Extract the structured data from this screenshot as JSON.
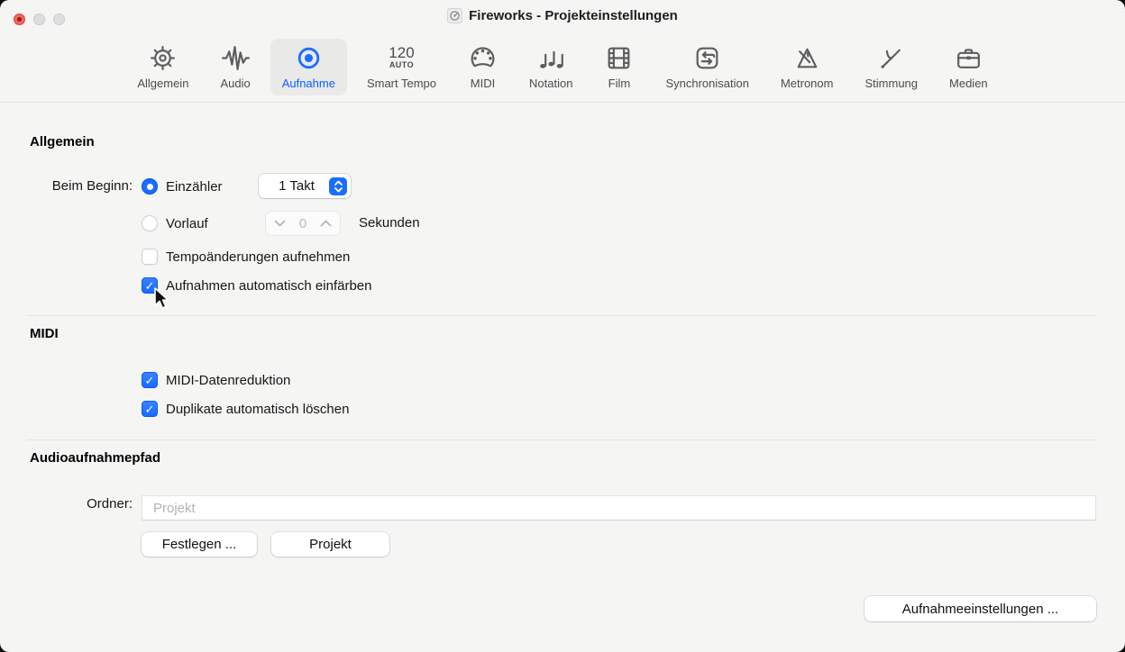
{
  "window": {
    "title": "Fireworks - Projekteinstellungen"
  },
  "toolbar": {
    "tabs": [
      {
        "label": "Allgemein",
        "icon": "gear-icon",
        "selected": false
      },
      {
        "label": "Audio",
        "icon": "waveform-icon",
        "selected": false
      },
      {
        "label": "Aufnahme",
        "icon": "record-icon",
        "selected": true
      },
      {
        "label": "Smart Tempo",
        "icon": "smart-tempo-icon",
        "icon_text_top": "120",
        "icon_text_bottom": "AUTO",
        "selected": false
      },
      {
        "label": "MIDI",
        "icon": "midi-connector-icon",
        "selected": false
      },
      {
        "label": "Notation",
        "icon": "music-notes-icon",
        "selected": false
      },
      {
        "label": "Film",
        "icon": "film-strip-icon",
        "selected": false
      },
      {
        "label": "Synchronisation",
        "icon": "sync-arrows-icon",
        "selected": false
      },
      {
        "label": "Metronom",
        "icon": "metronome-icon",
        "selected": false
      },
      {
        "label": "Stimmung",
        "icon": "tuning-fork-icon",
        "selected": false
      },
      {
        "label": "Medien",
        "icon": "briefcase-icon",
        "selected": false
      }
    ]
  },
  "sections": {
    "allgemein": {
      "title": "Allgemein",
      "beim_beginn_label": "Beim Beginn:",
      "einzaehler": {
        "label": "Einzähler",
        "selected": true,
        "popup_value": "1 Takt"
      },
      "vorlauf": {
        "label": "Vorlauf",
        "selected": false,
        "stepper_value": "0",
        "unit": "Sekunden"
      },
      "checkboxes": [
        {
          "label": "Tempoänderungen aufnehmen",
          "checked": false
        },
        {
          "label": "Aufnahmen automatisch einfärben",
          "checked": true
        }
      ]
    },
    "midi": {
      "title": "MIDI",
      "checkboxes": [
        {
          "label": "MIDI-Datenreduktion",
          "checked": true
        },
        {
          "label": "Duplikate automatisch löschen",
          "checked": true
        }
      ]
    },
    "audioaufnahmepfad": {
      "title": "Audioaufnahmepfad",
      "ordner_label": "Ordner:",
      "field_placeholder": "Projekt",
      "festlegen_button": "Festlegen ...",
      "projekt_button": "Projekt"
    }
  },
  "footer": {
    "aufnahmeeinstellungen_button": "Aufnahmeeinstellungen ..."
  },
  "glyphs": {
    "check": "✓"
  },
  "colors": {
    "accent": "#1a6dff",
    "background": "#f5f5f4",
    "close_red": "#f3655d"
  }
}
